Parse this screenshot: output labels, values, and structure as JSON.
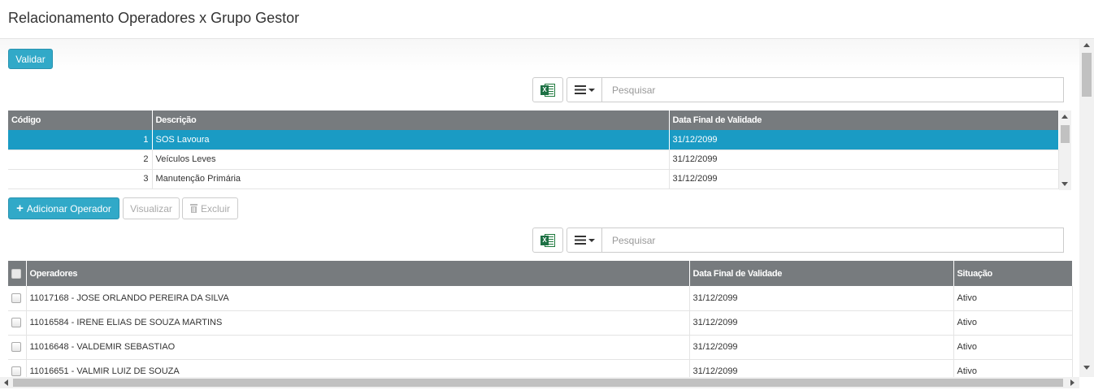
{
  "page": {
    "title": "Relacionamento Operadores x Grupo Gestor"
  },
  "toolbar1": {
    "validate_label": "Validar",
    "search_placeholder": "Pesquisar",
    "excel_badge": "X"
  },
  "table1": {
    "columns": [
      "Código",
      "Descrição",
      "Data Final de Validade"
    ],
    "rows": [
      {
        "code": "1",
        "description": "SOS Lavoura",
        "date": "31/12/2099",
        "selected": true
      },
      {
        "code": "2",
        "description": "Veículos Leves",
        "date": "31/12/2099",
        "selected": false
      },
      {
        "code": "3",
        "description": "Manutenção Primária",
        "date": "31/12/2099",
        "selected": false
      }
    ]
  },
  "actions": {
    "add_label": "Adicionar Operador",
    "view_label": "Visualizar",
    "delete_label": "Excluir"
  },
  "toolbar2": {
    "search_placeholder": "Pesquisar",
    "excel_badge": "X"
  },
  "table2": {
    "columns": [
      "Operadores",
      "Data Final de Validade",
      "Situação"
    ],
    "rows": [
      {
        "operator": "11017168 - JOSE ORLANDO PEREIRA DA SILVA",
        "date": "31/12/2099",
        "status": "Ativo"
      },
      {
        "operator": "11016584 - IRENE ELIAS DE SOUZA MARTINS",
        "date": "31/12/2099",
        "status": "Ativo"
      },
      {
        "operator": "11016648 - VALDEMIR SEBASTIAO",
        "date": "31/12/2099",
        "status": "Ativo"
      },
      {
        "operator": "11016651 - VALMIR LUIZ DE SOUZA",
        "date": "31/12/2099",
        "status": "Ativo"
      }
    ]
  },
  "colors": {
    "accent": "#31a9c8",
    "selected_row": "#1a9bc4",
    "table_header": "#777b7e"
  }
}
